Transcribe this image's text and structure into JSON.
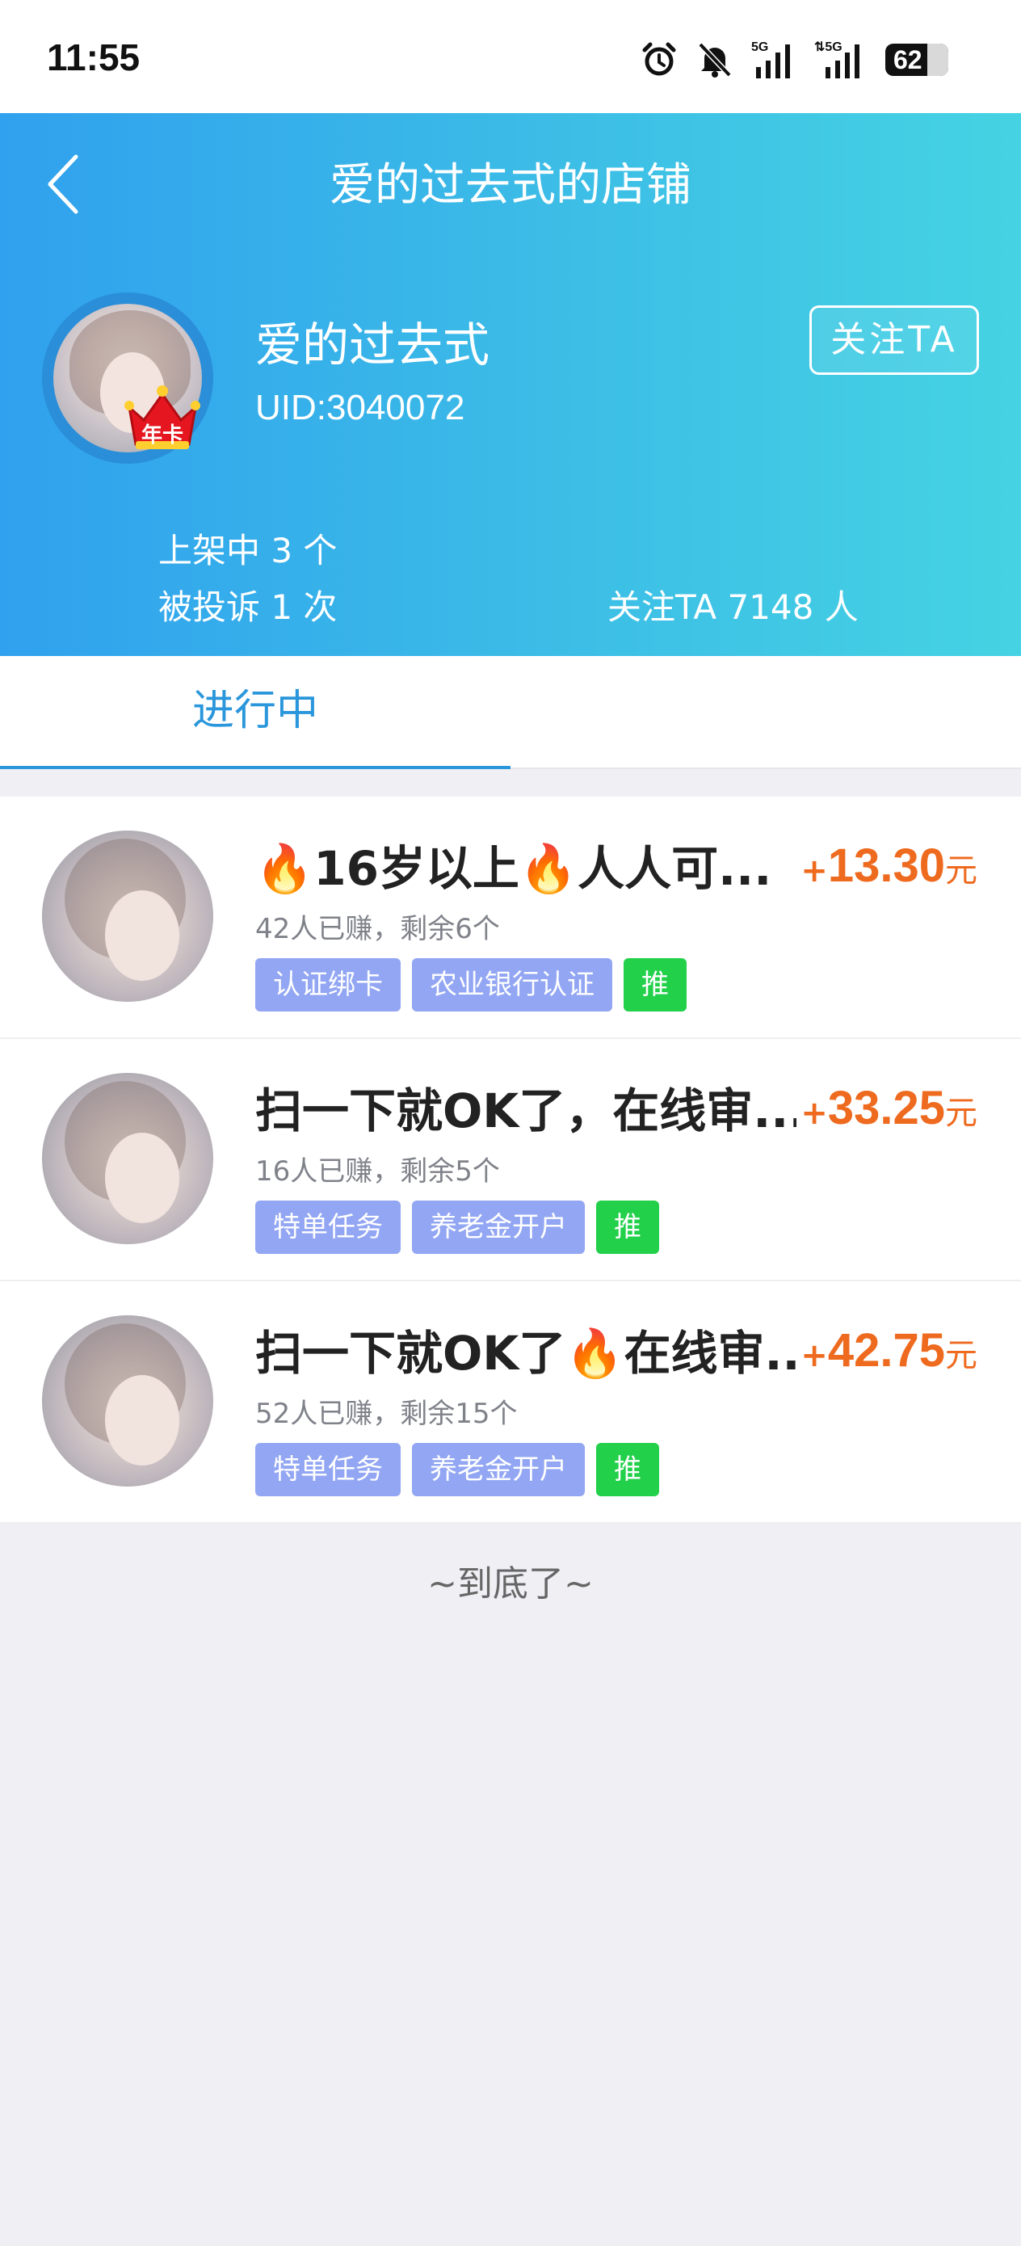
{
  "status_bar": {
    "time": "11:55",
    "battery": "62",
    "icons": [
      "alarm-icon",
      "mute-icon",
      "signal-5g-icon",
      "signal-5g-icon",
      "battery-icon"
    ]
  },
  "header": {
    "title": "爱的过去式的店铺",
    "back_icon": "chevron-left-icon"
  },
  "profile": {
    "name": "爱的过去式",
    "uid": "UID:3040072",
    "badge": "年卡",
    "follow_button": "关注TA",
    "listed": "上架中 3 个",
    "complaints": "被投诉 1 次",
    "followers": "关注TA 7148 人"
  },
  "tabs": [
    {
      "label": "进行中",
      "active": true
    }
  ],
  "tasks": [
    {
      "title": "🔥16岁以上🔥人人可...",
      "reward_plus": "+",
      "reward_amount": "13.30",
      "reward_unit": "元",
      "meta": "42人已赚，剩余6个",
      "tags": [
        "认证绑卡",
        "农业银行认证"
      ],
      "push": "推"
    },
    {
      "title": "扫一下就OK了，在线审...",
      "reward_plus": "+",
      "reward_amount": "33.25",
      "reward_unit": "元",
      "meta": "16人已赚，剩余5个",
      "tags": [
        "特单任务",
        "养老金开户"
      ],
      "push": "推"
    },
    {
      "title": "扫一下就OK了🔥在线审...",
      "reward_plus": "+",
      "reward_amount": "42.75",
      "reward_unit": "元",
      "meta": "52人已赚，剩余15个",
      "tags": [
        "特单任务",
        "养老金开户"
      ],
      "push": "推"
    }
  ],
  "footer": {
    "end_text": "~到底了~"
  },
  "colors": {
    "header_gradient_start": "#30a1ee",
    "header_gradient_end": "#45d3e3",
    "accent_blue": "#2a96db",
    "reward_orange": "#ee6a1f",
    "tag_blue": "#92a6f3",
    "tag_green": "#22d04a",
    "page_bg": "#efeff4"
  }
}
